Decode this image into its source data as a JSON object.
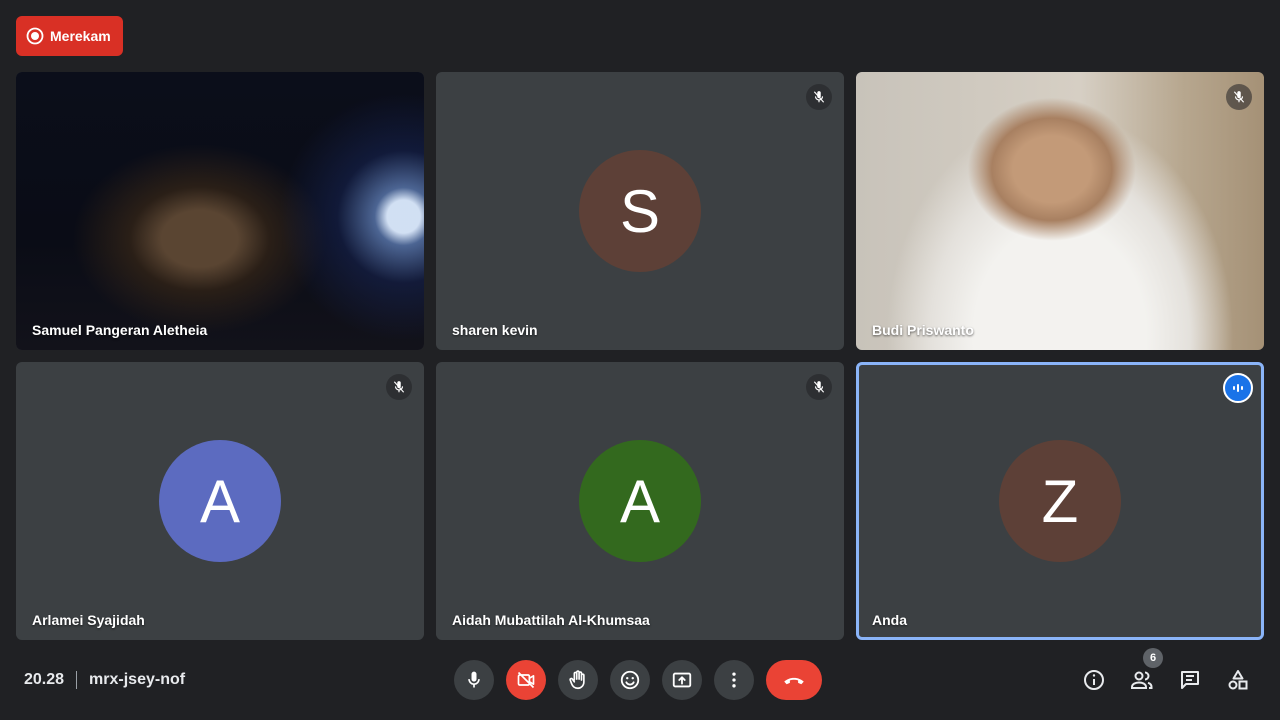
{
  "recording": {
    "label": "Merekam",
    "color": "#d93025"
  },
  "participants": [
    {
      "name": "Samuel Pangeran Aletheia",
      "video": true,
      "muted": false
    },
    {
      "name": "sharen kevin",
      "initial": "S",
      "avatar_color": "#5d4037",
      "muted": true
    },
    {
      "name": "Budi Priswanto",
      "video": true,
      "muted": true
    },
    {
      "name": "Arlamei Syajidah",
      "initial": "A",
      "avatar_color": "#5c6bc0",
      "muted": true
    },
    {
      "name": "Aidah Mubattilah Al-Khumsaa",
      "initial": "A",
      "avatar_color": "#33691e",
      "muted": true
    },
    {
      "name": "Anda",
      "initial": "Z",
      "avatar_color": "#5d4037",
      "speaking": true
    }
  ],
  "meeting": {
    "time": "20.28",
    "code": "mrx-jsey-nof"
  },
  "controls": [
    {
      "icon": "mic-icon"
    },
    {
      "icon": "camera-off-icon",
      "color": "#ea4335"
    },
    {
      "icon": "raise-hand-icon"
    },
    {
      "icon": "emoji-icon"
    },
    {
      "icon": "present-screen-icon"
    },
    {
      "icon": "more-options-icon"
    },
    {
      "icon": "hang-up-icon",
      "color": "#ea4335"
    }
  ],
  "side_controls": {
    "participants_count": "6",
    "icons": [
      "info-icon",
      "people-icon",
      "chat-icon",
      "activities-icon"
    ]
  },
  "accent": "#8ab4f8"
}
